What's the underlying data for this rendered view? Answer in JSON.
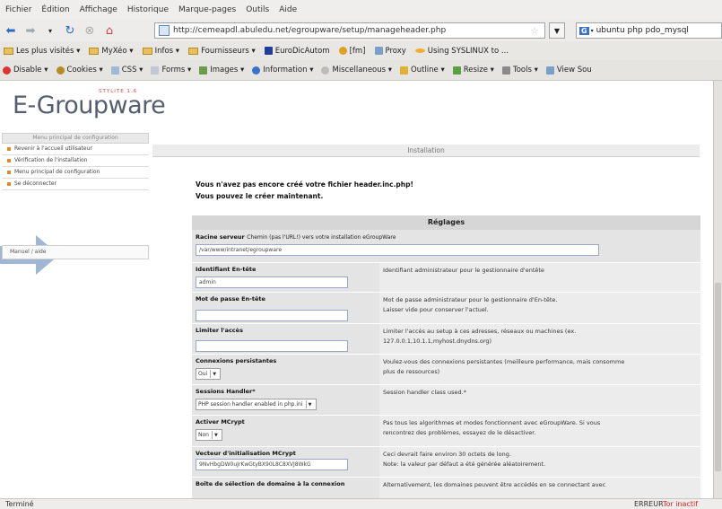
{
  "browser": {
    "menu": [
      "Fichier",
      "Édition",
      "Affichage",
      "Historique",
      "Marque-pages",
      "Outils",
      "Aide"
    ],
    "url": "http://cemeapdl.abuledu.net/egroupware/setup/manageheader.php",
    "search_text": "ubuntu php pdo_mysql",
    "bookmarks": [
      "Les plus visités ▾",
      "MyXéo ▾",
      "Infos ▾",
      "Fournisseurs ▾",
      "EuroDicAutom",
      "[fm]",
      "Proxy",
      "Using SYSLINUX to ..."
    ],
    "devtools": [
      "Disable ▾",
      "Cookies ▾",
      "CSS ▾",
      "Forms ▾",
      "Images ▾",
      "Information ▾",
      "Miscellaneous ▾",
      "Outline ▾",
      "Resize ▾",
      "Tools ▾",
      "View Sou"
    ],
    "status_left": "Terminé",
    "status_error": "ERREUR",
    "status_tor": "Tor inactif"
  },
  "logo": {
    "stylite": "STYLITE 1.6",
    "name": "E-Groupware"
  },
  "sidebar": {
    "heading": "Menu principal de configuration",
    "items": [
      "Revenir à l'accueil utilisateur",
      "Vérification de l'installation",
      "Menu principal de configuration",
      "Se déconnecter"
    ],
    "manual": "Manuel / aide"
  },
  "main": {
    "heading": "Installation",
    "msg1": "Vous n'avez pas encore créé votre fichier header.inc.php!",
    "msg2": "Vous pouvez le créer maintenant.",
    "table_title": "Réglages",
    "root_label": "Racine serveur",
    "root_desc": "Chemin (pas l'URL!) vers votre installation eGroupWare",
    "root_value": "/var/www/intranet/egroupware",
    "rows": [
      {
        "label": "Identifiant En-tête",
        "input": "admin",
        "desc": [
          "Identifiant administrateur pour le gestionnaire d'entête"
        ]
      },
      {
        "label": "Mot de passe En-tête",
        "input": "",
        "desc": [
          "Mot de passe administrateur pour le gestionnaire d'En-tête.",
          "Laisser vide pour conserver l'actuel."
        ]
      },
      {
        "label": "Limiter l'accès",
        "input": "",
        "desc": [
          "Limiter l'accès au setup à ces adresses, réseaux ou machines (ex.",
          "127.0.0.1,10.1.1,myhost.dnydns.org)"
        ]
      },
      {
        "label": "Connexions persistantes",
        "select": "Oui",
        "desc": [
          "Voulez-vous des connexions persistantes (meilleure performance, mais consomme",
          "plus de ressources)"
        ]
      },
      {
        "label": "Sessions Handler*",
        "select": "PHP session handler enabled in php.ini",
        "desc": [
          "Session handler class used.*"
        ]
      },
      {
        "label": "Activer MCrypt",
        "select": "Non",
        "desc": [
          "Pas tous les algorithmes et modes fonctionnent avec eGroupWare. Si vous",
          "rencontrez des problèmes, essayez de le désactiver."
        ]
      },
      {
        "label": "Vecteur d'initialisation MCrypt",
        "input": "9NvHbgDW0uJrKwGtyBX90L8C8XVJ8WkG",
        "desc": [
          "Ceci devrait faire environ 30 octets de long.",
          "Note: la valeur par défaut a été générée aléatoirement."
        ]
      },
      {
        "label": "Boîte de sélection de domaine à la connexion",
        "desc": [
          "Alternativement, les domaines peuvent être accédés en se connectant avec"
        ]
      }
    ]
  }
}
